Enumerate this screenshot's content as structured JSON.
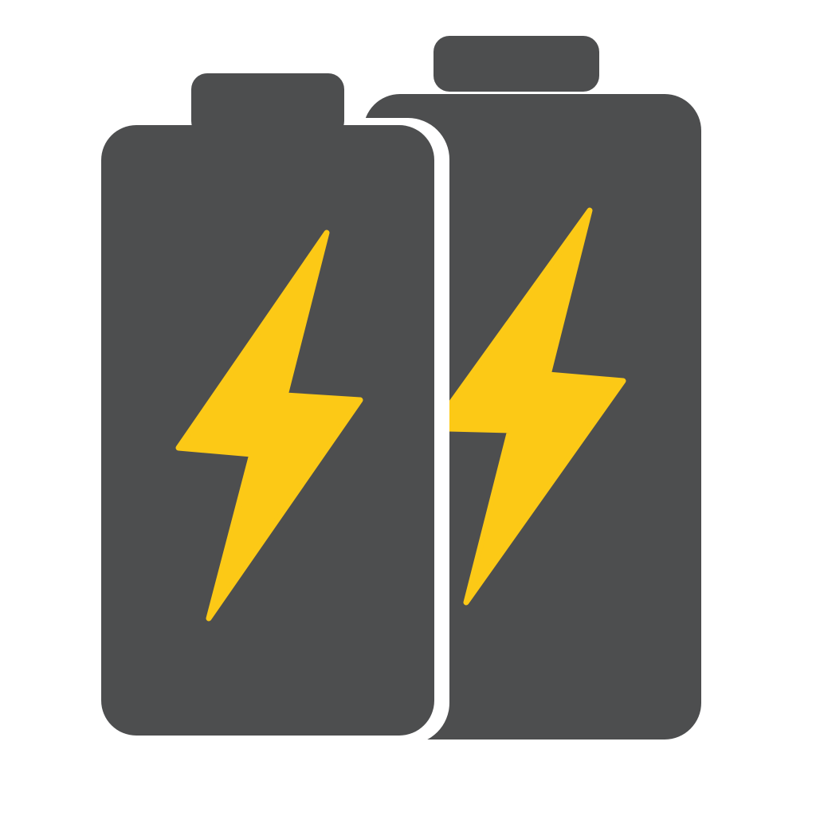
{
  "icon": "two-charging-batteries-icon",
  "colors": {
    "background": "#ffffff",
    "battery_body": "#4d4e4f",
    "separator": "#ffffff",
    "bolt": "#fcc916"
  },
  "batteries": [
    {
      "icon": "battery-icon",
      "bolt_icon": "lightning-bolt-icon"
    },
    {
      "icon": "battery-icon",
      "bolt_icon": "lightning-bolt-icon"
    }
  ]
}
